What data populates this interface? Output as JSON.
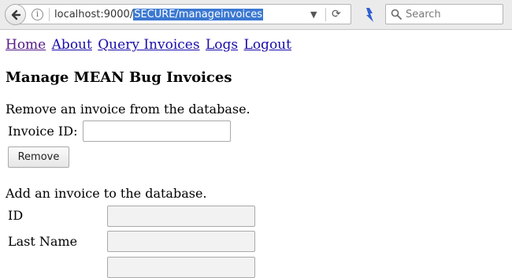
{
  "browser": {
    "url_prefix": "localhost:9000/",
    "url_selected": "SECURE/manageinvoices",
    "search_placeholder": "Search",
    "info_glyph": "i",
    "dropdown_glyph": "▼",
    "reload_glyph": "⟳",
    "icons": [
      "back-arrow-icon",
      "info-icon",
      "chevron-down-icon",
      "reload-icon",
      "extension-icon",
      "search-icon"
    ]
  },
  "nav": {
    "links": [
      "Home",
      "About",
      "Query Invoices",
      "Logs",
      "Logout"
    ]
  },
  "page": {
    "title": "Manage MEAN Bug Invoices"
  },
  "remove_section": {
    "heading": "Remove an invoice from the database.",
    "invoice_id_label": "Invoice ID:",
    "invoice_id_value": "",
    "remove_button": "Remove"
  },
  "add_section": {
    "heading": "Add an invoice to the database.",
    "id_label": "ID",
    "id_value": "",
    "last_name_label": "Last Name",
    "last_name_value": ""
  },
  "colors": {
    "link": "#1a0dab",
    "visited_link": "#551a8b",
    "url_selection": "#3b78d1",
    "toolbar_bg": "#ebebeb"
  }
}
